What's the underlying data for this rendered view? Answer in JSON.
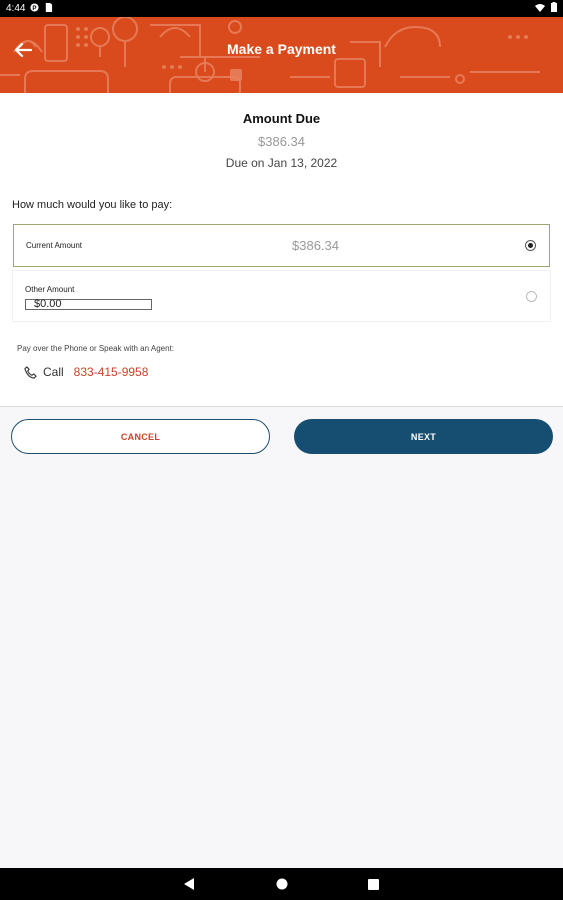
{
  "status_bar": {
    "time": "4:44",
    "left_icons": [
      "app-icon",
      "sim-card-icon"
    ],
    "right_icons": [
      "wifi-icon",
      "battery-icon"
    ]
  },
  "header": {
    "title": "Make a Payment",
    "back_icon": "back-arrow-icon",
    "background_color": "#d94a1c"
  },
  "amount_due": {
    "title": "Amount Due",
    "amount": "$386.34",
    "due_date": "Due on Jan 13, 2022"
  },
  "payment_options": {
    "question": "How much would you like to pay:",
    "current": {
      "label": "Current Amount",
      "amount": "$386.34",
      "selected": true
    },
    "other": {
      "label": "Other Amount",
      "value": "$0.00",
      "selected": false
    }
  },
  "phone": {
    "note": "Pay over the Phone or Speak with an Agent:",
    "call_label": "Call",
    "number": "833-415-9958",
    "icon": "phone-icon"
  },
  "buttons": {
    "cancel": "CANCEL",
    "next": "NEXT"
  },
  "colors": {
    "accent": "#c8432a",
    "primary": "#164e72"
  },
  "nav_bar": {
    "icons": [
      "nav-back-icon",
      "nav-home-icon",
      "nav-recents-icon"
    ]
  }
}
